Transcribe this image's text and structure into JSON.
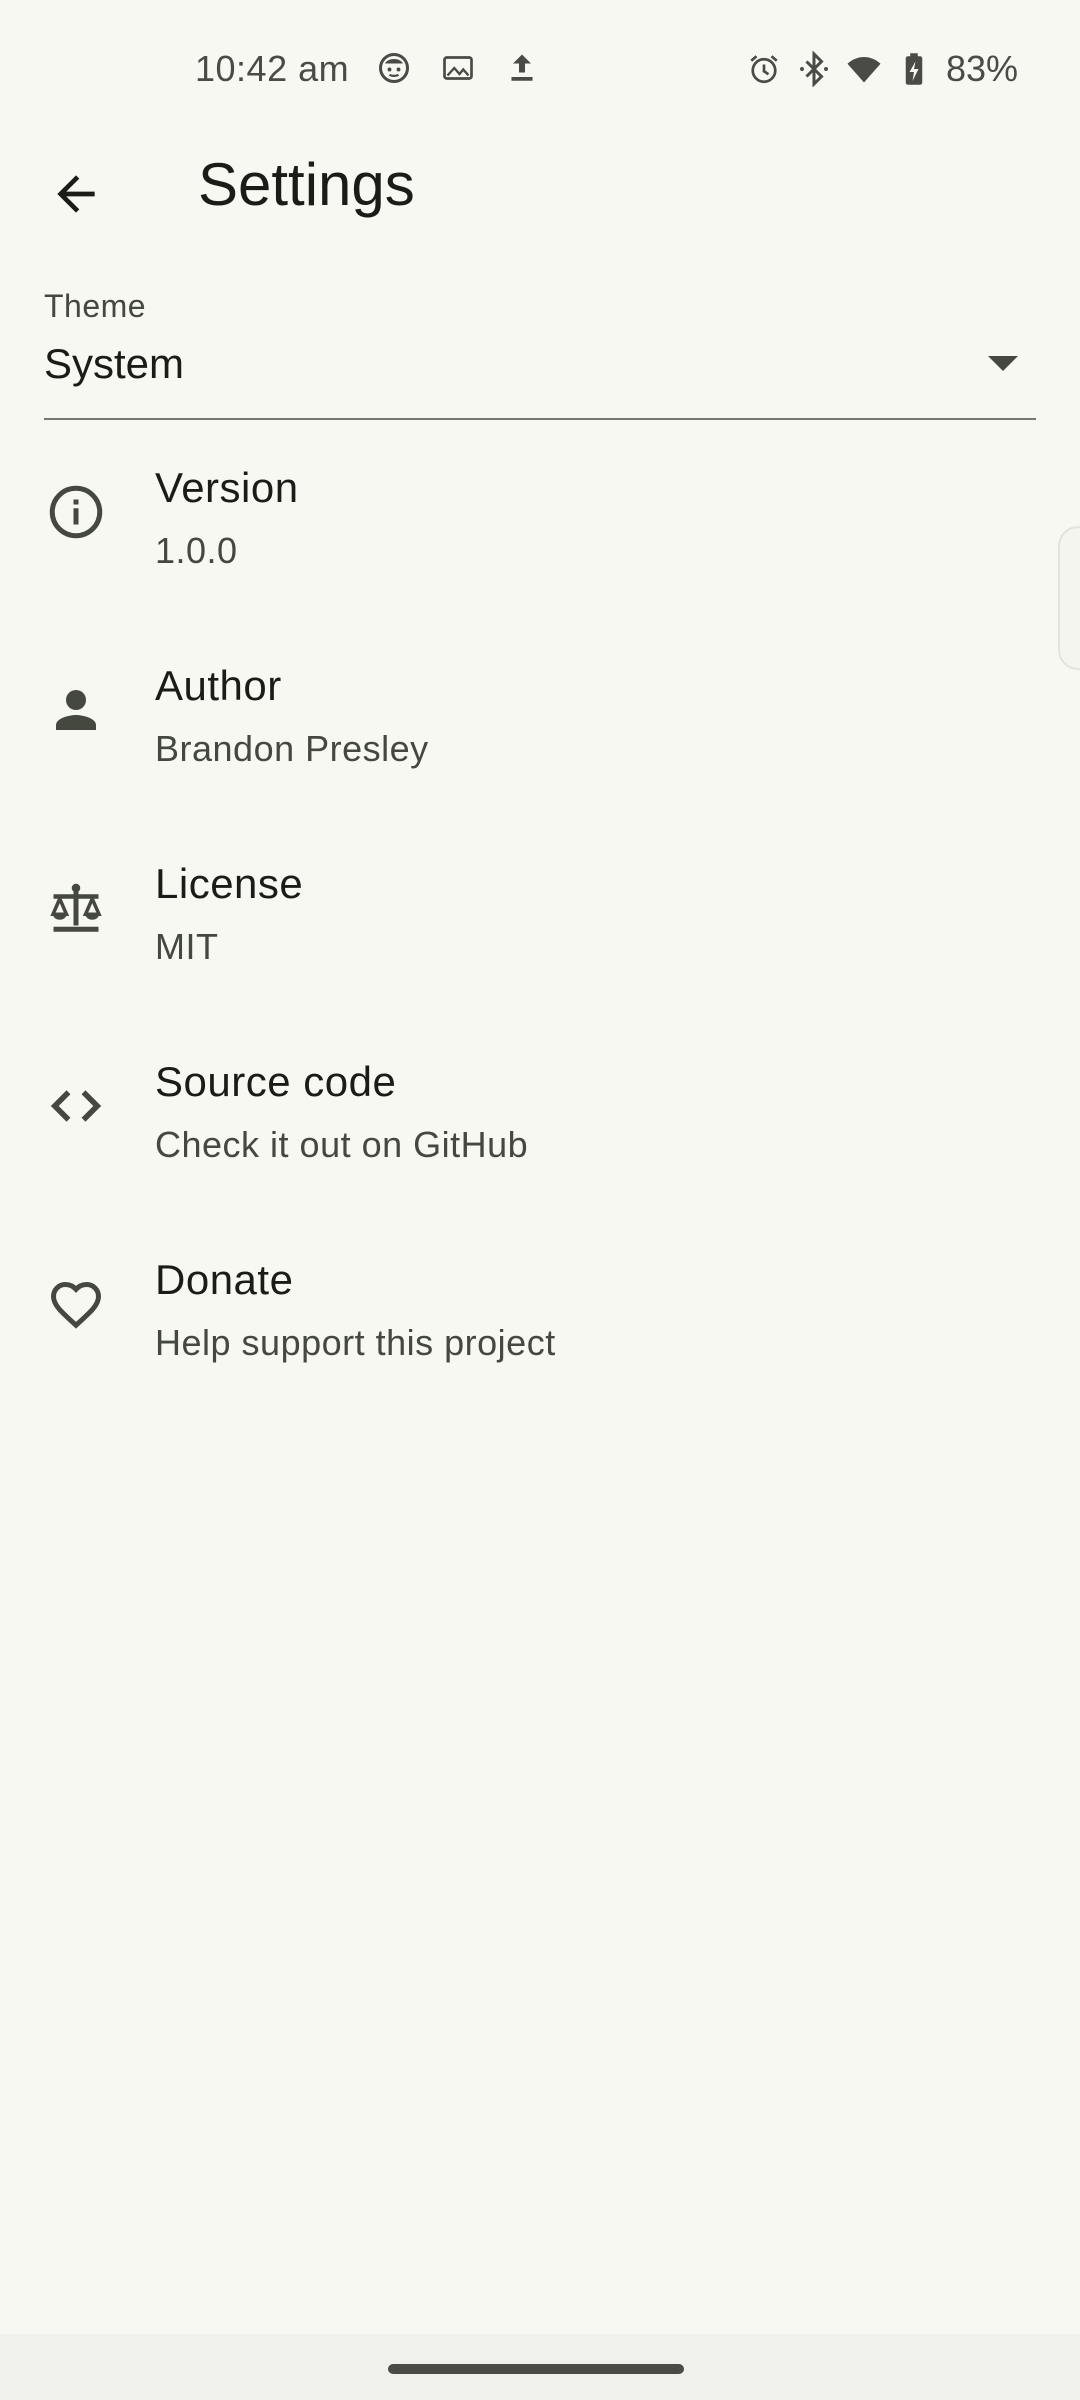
{
  "status_bar": {
    "time": "10:42 am",
    "battery_percent": "83%",
    "left_icons": [
      "face-notification-icon",
      "image-icon",
      "upload-icon"
    ],
    "right_icons": [
      "alarm-icon",
      "bluetooth-icon",
      "wifi-icon",
      "battery-charging-icon"
    ]
  },
  "app_bar": {
    "title": "Settings",
    "back_icon": "arrow-back-icon"
  },
  "theme": {
    "label": "Theme",
    "value": "System"
  },
  "items": [
    {
      "icon": "info-icon",
      "title": "Version",
      "subtitle": "1.0.0"
    },
    {
      "icon": "person-icon",
      "title": "Author",
      "subtitle": "Brandon Presley"
    },
    {
      "icon": "balance-scale-icon",
      "title": "License",
      "subtitle": "MIT"
    },
    {
      "icon": "code-icon",
      "title": "Source code",
      "subtitle": "Check it out on GitHub"
    },
    {
      "icon": "heart-icon",
      "title": "Donate",
      "subtitle": "Help support this project"
    }
  ],
  "colors": {
    "background": "#f6f8f1",
    "text_primary": "#1b1c18",
    "text_secondary": "#44483f"
  }
}
